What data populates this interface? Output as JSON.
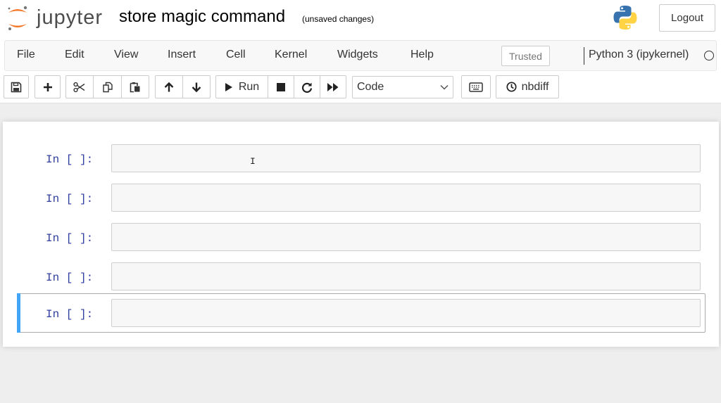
{
  "app": {
    "logo_text": "jupyter",
    "notebook_title": "store magic command",
    "save_status": "(unsaved changes)",
    "logout_label": "Logout"
  },
  "menu": {
    "items": [
      "File",
      "Edit",
      "View",
      "Insert",
      "Cell",
      "Kernel",
      "Widgets",
      "Help"
    ],
    "trusted_label": "Trusted",
    "kernel_name": "Python 3 (ipykernel)",
    "kernel_status": "idle"
  },
  "toolbar": {
    "buttons": [
      {
        "icon": "save-icon"
      },
      {
        "icon": "plus-icon"
      },
      {
        "icon": "cut-icon"
      },
      {
        "icon": "copy-icon"
      },
      {
        "icon": "paste-icon"
      },
      {
        "icon": "arrow-up-icon"
      },
      {
        "icon": "arrow-down-icon"
      },
      {
        "icon": "play-icon",
        "label": "Run"
      },
      {
        "icon": "stop-icon"
      },
      {
        "icon": "restart-icon"
      },
      {
        "icon": "fast-forward-icon"
      },
      {
        "icon": "keyboard-icon"
      },
      {
        "icon": "clock-icon",
        "label": "nbdiff"
      }
    ],
    "cell_type": "Code"
  },
  "cells": [
    {
      "prompt": "In [ ]:",
      "selected": false
    },
    {
      "prompt": "In [ ]:",
      "selected": false
    },
    {
      "prompt": "In [ ]:",
      "selected": false
    },
    {
      "prompt": "In [ ]:",
      "selected": false
    },
    {
      "prompt": "In [ ]:",
      "selected": true
    }
  ],
  "colors": {
    "accent_selected_cell": "#42a5f5",
    "prompt": "#303f9f",
    "jupyter_orange": "#f37726"
  }
}
